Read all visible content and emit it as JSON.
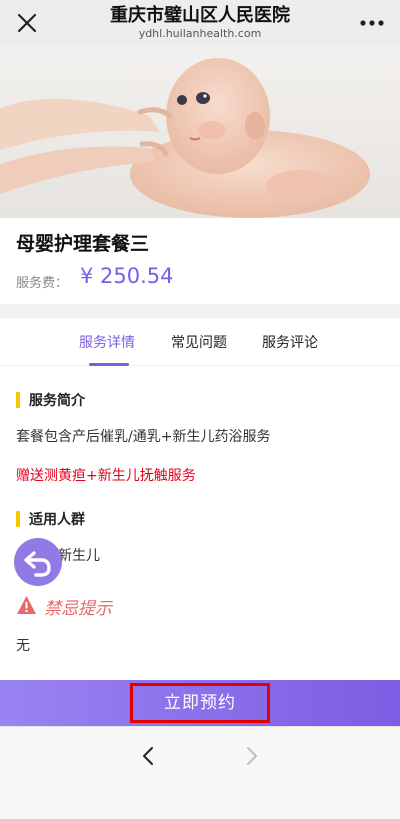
{
  "header": {
    "title": "重庆市璧山区人民医院",
    "url": "ydhl.huilanhealth.com",
    "close_icon": "close-icon",
    "more_icon": "more-dots-icon"
  },
  "product": {
    "title": "母婴护理套餐三",
    "fee_label": "服务费：",
    "price": "¥ 250.54"
  },
  "tabs": [
    {
      "label": "服务详情",
      "active": true
    },
    {
      "label": "常见问题",
      "active": false
    },
    {
      "label": "服务评论",
      "active": false
    }
  ],
  "sections": {
    "intro_heading": "服务简介",
    "intro_text": "套餐包含产后催乳/通乳+新生儿药浴服务",
    "gift_text": "赠送测黄疸+新生儿抚触服务",
    "audience_heading": "适用人群",
    "audience_text": "产妇、新生儿",
    "warning_heading": "禁忌提示",
    "warning_text": "无"
  },
  "booking": {
    "button_label": "立即预约"
  },
  "colors": {
    "accent": "#7c5de3",
    "highlight_bar": "#f6c700",
    "red_text": "#e0001b",
    "warning": "#e86969"
  }
}
